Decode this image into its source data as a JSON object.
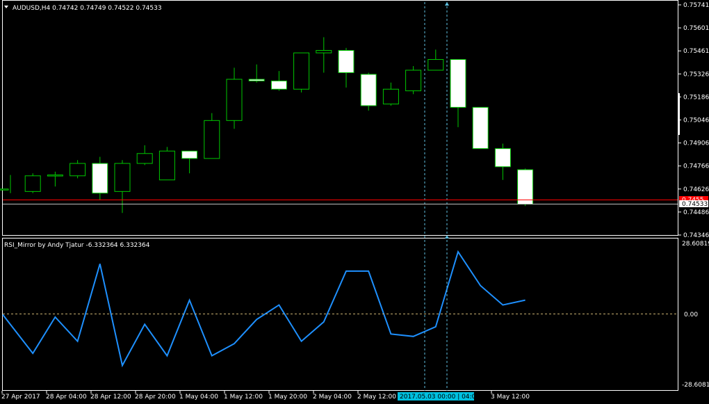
{
  "header": {
    "dropdown_icon": "triangle-down-icon",
    "title": "AUDUSD,H4  0.74742 0.74749 0.74522 0.74533"
  },
  "indicator": {
    "title": "RSI_Mirror by Andy Tjatur -6.332364 6.332364",
    "scale_labels": [
      "28.60819",
      "0.00",
      "-28.60819"
    ]
  },
  "colors": {
    "background": "#000000",
    "bull_candle": "#00c800",
    "bear_candle_fill": "#ffffff",
    "rsi_line": "#1e90ff",
    "bid_line": "#ff0000",
    "crosshair": "#5fc0e0",
    "time_highlight": "#00c0e0"
  },
  "price_scale": [
    "0.75741",
    "0.75601",
    "0.75461",
    "0.75326",
    "0.75186",
    "0.75046",
    "0.74906",
    "0.74766",
    "0.74626",
    "0.74486",
    "0.74346"
  ],
  "price_tags": {
    "bid": "0.74533",
    "ask_partial": "0.7455"
  },
  "time_labels": [
    "27 Apr 2017",
    "28 Apr 04:00",
    "28 Apr 12:00",
    "28 Apr 20:00",
    "1 May 04:00",
    "1 May 12:00",
    "1 May 20:00",
    "2 May 04:00",
    "2 May 12:00",
    "3 May 12:00"
  ],
  "crosshair_time": "2017.05.03 00:00 | 04:00",
  "chart_data": [
    {
      "type": "candlestick",
      "title": "AUDUSD,H4",
      "ylim": [
        0.74346,
        0.75741
      ],
      "candles": [
        {
          "o": 0.74625,
          "h": 0.7471,
          "l": 0.746,
          "c": 0.74625
        },
        {
          "o": 0.7461,
          "h": 0.7472,
          "l": 0.746,
          "c": 0.74705
        },
        {
          "o": 0.74705,
          "h": 0.7473,
          "l": 0.7464,
          "c": 0.7471
        },
        {
          "o": 0.74705,
          "h": 0.748,
          "l": 0.7469,
          "c": 0.7478
        },
        {
          "o": 0.7478,
          "h": 0.7482,
          "l": 0.7456,
          "c": 0.746
        },
        {
          "o": 0.7461,
          "h": 0.748,
          "l": 0.7448,
          "c": 0.7478
        },
        {
          "o": 0.7478,
          "h": 0.7489,
          "l": 0.7477,
          "c": 0.7484
        },
        {
          "o": 0.7468,
          "h": 0.7488,
          "l": 0.7468,
          "c": 0.74855
        },
        {
          "o": 0.74855,
          "h": 0.74855,
          "l": 0.7472,
          "c": 0.7481
        },
        {
          "o": 0.7481,
          "h": 0.75085,
          "l": 0.7481,
          "c": 0.7504
        },
        {
          "o": 0.7504,
          "h": 0.7536,
          "l": 0.7499,
          "c": 0.7529
        },
        {
          "o": 0.7529,
          "h": 0.7538,
          "l": 0.7527,
          "c": 0.7528
        },
        {
          "o": 0.7528,
          "h": 0.7534,
          "l": 0.7522,
          "c": 0.7523
        },
        {
          "o": 0.7523,
          "h": 0.754,
          "l": 0.7521,
          "c": 0.7545
        },
        {
          "o": 0.7545,
          "h": 0.75545,
          "l": 0.7533,
          "c": 0.75465
        },
        {
          "o": 0.75465,
          "h": 0.7548,
          "l": 0.7524,
          "c": 0.7533
        },
        {
          "o": 0.7532,
          "h": 0.7533,
          "l": 0.751,
          "c": 0.7513
        },
        {
          "o": 0.7514,
          "h": 0.7527,
          "l": 0.7513,
          "c": 0.7523
        },
        {
          "o": 0.7522,
          "h": 0.7537,
          "l": 0.752,
          "c": 0.75345
        },
        {
          "o": 0.75345,
          "h": 0.7547,
          "l": 0.75345,
          "c": 0.7541
        },
        {
          "o": 0.7541,
          "h": 0.7541,
          "l": 0.75,
          "c": 0.7512
        },
        {
          "o": 0.7512,
          "h": 0.7512,
          "l": 0.7488,
          "c": 0.7487
        },
        {
          "o": 0.7487,
          "h": 0.749,
          "l": 0.7468,
          "c": 0.7476
        },
        {
          "o": 0.74742,
          "h": 0.74749,
          "l": 0.74522,
          "c": 0.74533
        }
      ],
      "bid": 0.74533
    },
    {
      "type": "line",
      "title": "RSI_Mirror by Andy Tjatur",
      "ylim": [
        -28.60819,
        28.60819
      ],
      "series": [
        {
          "values": [
            0,
            -16,
            -1,
            -11,
            21,
            -21,
            -4,
            -17,
            6,
            -17,
            -12,
            -2,
            4,
            -11,
            -3,
            18,
            18,
            -8,
            -9,
            -5,
            26,
            12,
            4,
            6
          ]
        }
      ]
    }
  ]
}
